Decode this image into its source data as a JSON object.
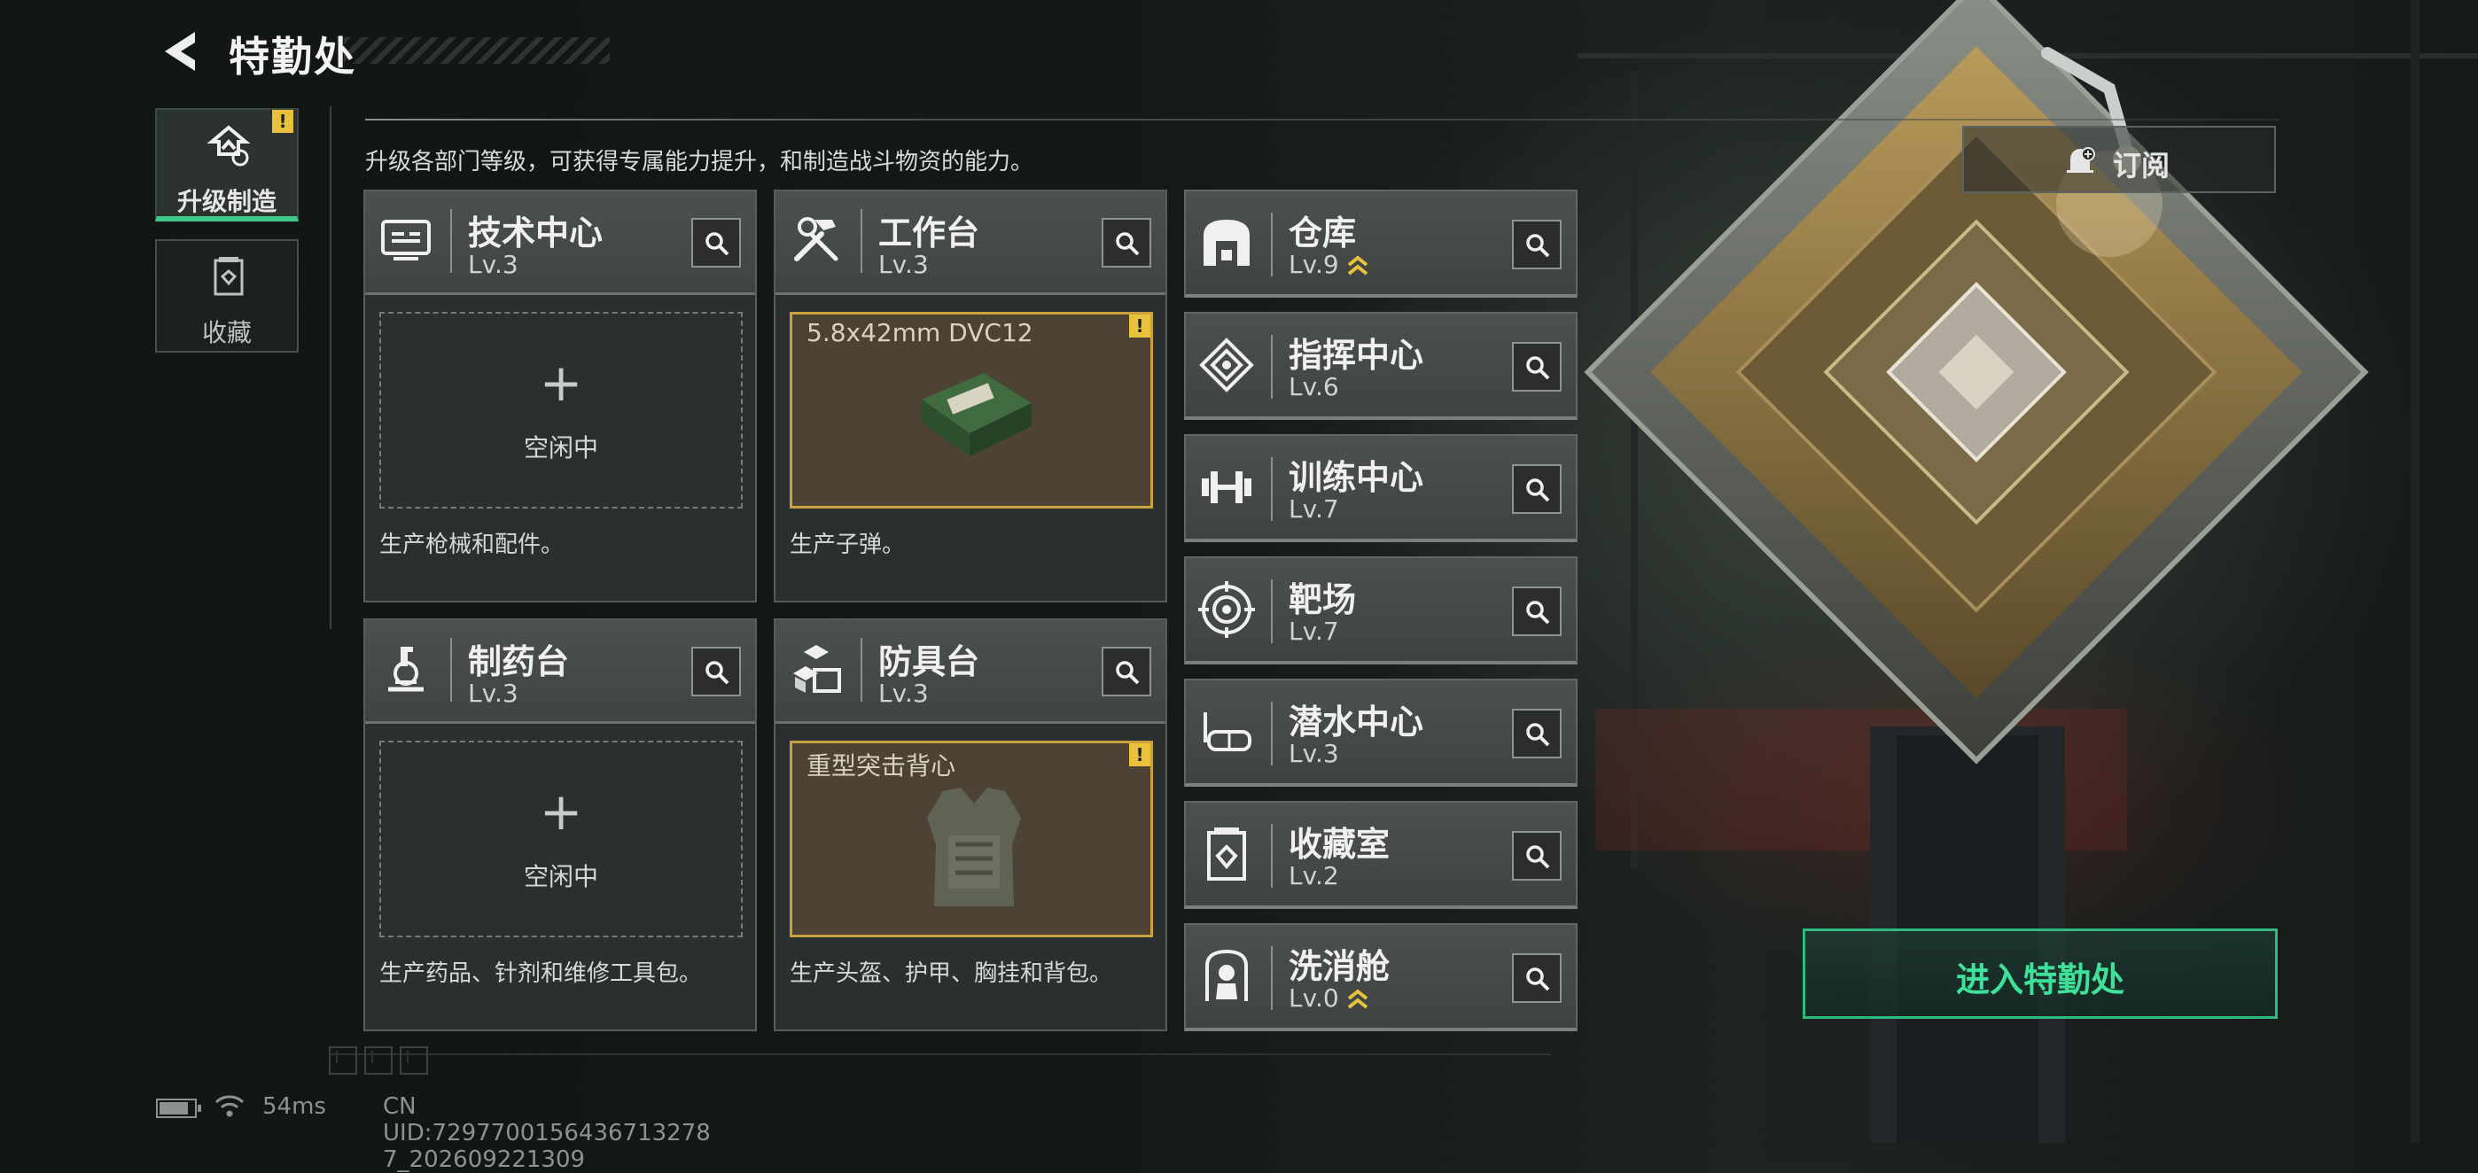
{
  "header": {
    "title": "特勤处"
  },
  "side_tabs": [
    {
      "label": "升级制造",
      "icon": "upgrade-icon",
      "active": true,
      "alert": "!"
    },
    {
      "label": "收藏",
      "icon": "collection-icon",
      "active": false
    }
  ],
  "description": "升级各部门等级，可获得专属能力提升，和制造战斗物资的能力。",
  "subscribe": {
    "label": "订阅",
    "icon": "bell-icon"
  },
  "workstations": [
    {
      "name": "技术中心",
      "level": "Lv.3",
      "icon": "tech-center-icon",
      "slot": {
        "state": "empty",
        "plus": "+",
        "label": "空闲中"
      },
      "desc": "生产枪械和配件。"
    },
    {
      "name": "工作台",
      "level": "Lv.3",
      "icon": "hammer-wrench-icon",
      "slot": {
        "state": "producing",
        "item": "5.8x42mm DVC12",
        "item_icon": "ammo-box-icon",
        "alert": "!"
      },
      "desc": "生产子弹。"
    },
    {
      "name": "制药台",
      "level": "Lv.3",
      "icon": "microscope-icon",
      "slot": {
        "state": "empty",
        "plus": "+",
        "label": "空闲中"
      },
      "desc": "生产药品、针剂和维修工具包。"
    },
    {
      "name": "防具台",
      "level": "Lv.3",
      "icon": "armor-blocks-icon",
      "slot": {
        "state": "producing",
        "item": "重型突击背心",
        "item_icon": "vest-icon",
        "alert": "!"
      },
      "desc": "生产头盔、护甲、胸挂和背包。"
    }
  ],
  "departments": [
    {
      "name": "仓库",
      "level": "Lv.9",
      "icon": "warehouse-icon",
      "upgradable": true
    },
    {
      "name": "指挥中心",
      "level": "Lv.6",
      "icon": "command-center-icon",
      "upgradable": false
    },
    {
      "name": "训练中心",
      "level": "Lv.7",
      "icon": "dumbbell-icon",
      "upgradable": false
    },
    {
      "name": "靶场",
      "level": "Lv.7",
      "icon": "target-icon",
      "upgradable": false
    },
    {
      "name": "潜水中心",
      "level": "Lv.3",
      "icon": "diving-mask-icon",
      "upgradable": false
    },
    {
      "name": "收藏室",
      "level": "Lv.2",
      "icon": "collection-room-icon",
      "upgradable": false
    },
    {
      "name": "洗消舱",
      "level": "Lv.0",
      "icon": "decontamination-icon",
      "upgradable": true
    }
  ],
  "enter_button": {
    "label": "进入特勤处"
  },
  "status": {
    "battery_level": 0.85,
    "ping": "54ms",
    "uid": "CN UID:7297700156436713278​7_202609221309"
  },
  "colors": {
    "accent_green": "#3fe09a",
    "alert_yellow": "#e8c23c",
    "producing_border": "#c9a23b"
  }
}
